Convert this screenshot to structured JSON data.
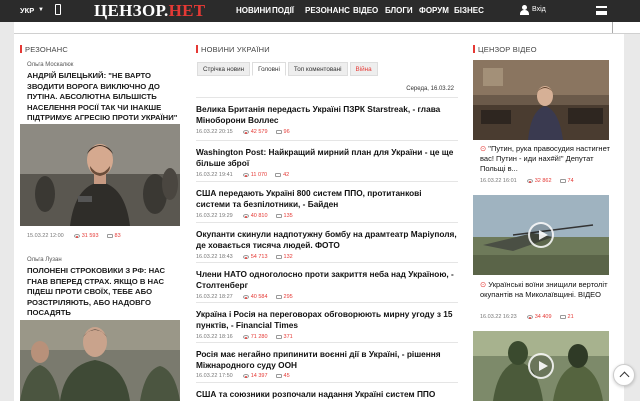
{
  "header": {
    "lang": "УКР",
    "logo_part1": "ЦЕНЗОР.",
    "logo_part2": "НЕТ",
    "nav": [
      "НОВИНИ",
      "ПОДІЇ",
      "РЕЗОНАНС",
      "ВІДЕО",
      "БЛОГИ",
      "ФОРУМ",
      "БІЗНЕС"
    ],
    "login": "Вхід"
  },
  "resonance": {
    "section_title": "РЕЗОНАНС",
    "cards": [
      {
        "author": "Ольга Москалюк",
        "title": "АНДРІЙ БІЛЕЦЬКИЙ: \"НЕ ВАРТО ЗВОДИТИ ВОРОГА ВИКЛЮЧНО ДО ПУТІНА. АБСОЛЮТНА БІЛЬШІСТЬ НАСЕЛЕННЯ РОСІЇ ТАК ЧИ ІНАКШЕ ПІДТРИМУЄ АГРЕСІЮ ПРОТИ УКРАЇНИ\"",
        "date": "15.03.22 12:00",
        "views": "31 593",
        "comments": "83"
      },
      {
        "author": "Ольга Лузан",
        "title": "ПОЛОНЕНІ СТРОКОВИКИ З РФ: НАС ГНАВ ВПЕРЕД СТРАХ. ЯКЩО В НАС ПІДЕШ ПРОТИ СВОЇХ, ТЕБЕ АБО РОЗСТРІЛЯЮТЬ, АБО НАДОВГО ПОСАДЯТЬ"
      }
    ]
  },
  "news": {
    "section_title": "НОВИНИ УКРАЇНИ",
    "tabs": [
      "Стрічка новин",
      "Головні",
      "Топ коментовані",
      "Війна"
    ],
    "date": "Середа, 16.03.22",
    "items": [
      {
        "title": "Велика Британія передасть Україні ПЗРК Starstreak, - глава Міноборони Воллес",
        "date": "16.03.22 20:15",
        "views": "42 579",
        "comments": "96"
      },
      {
        "title": "Washington Post: Найкращий мирний план для України - це ще більше зброї",
        "date": "16.03.22 19:41",
        "views": "11 070",
        "comments": "42"
      },
      {
        "title": "США передають Україні 800 систем ППО, протитанкові системи та безпілотники, - Байден",
        "date": "16.03.22 19:29",
        "views": "40 810",
        "comments": "135"
      },
      {
        "title": "Окупанти скинули надпотужну бомбу на драмтеатр Маріуполя, де ховається тисяча людей. ФОТО",
        "date": "16.03.22 18:43",
        "views": "54 713",
        "comments": "132"
      },
      {
        "title": "Члени НАТО одноголосно проти закриття неба над Україною, - Столтенберг",
        "date": "16.03.22 18:27",
        "views": "40 584",
        "comments": "295"
      },
      {
        "title": "Україна і Росія на переговорах обговорюють мирну угоду з 15 пунктів, - Financial Times",
        "date": "16.03.22 18:16",
        "views": "71 280",
        "comments": "371"
      },
      {
        "title": "Росія має негайно припинити воєнні дії в Україні, - рішення Міжнародного суду ООН",
        "date": "16.03.22 17:50",
        "views": "14 397",
        "comments": "45"
      },
      {
        "title": "США та союзники розпочали надання Україні систем ППО"
      }
    ]
  },
  "video": {
    "section_title": "ЦЕНЗОР ВІДЕО",
    "cards": [
      {
        "title": "\"Путин, рука правосудия настигнет вас! Путин - иди нах#й!\" Депутат Польщі в...",
        "date": "16.03.22 16:01",
        "views": "32 862",
        "comments": "74"
      },
      {
        "title": "Українські воїни знищили вертоліт окупантів на Миколаївщині. ВІДЕО",
        "date": "16.03.22 16:23",
        "views": "34 409",
        "comments": "21"
      }
    ]
  },
  "colors": {
    "accent": "#e53935",
    "topbar": "#2b2b2b"
  }
}
